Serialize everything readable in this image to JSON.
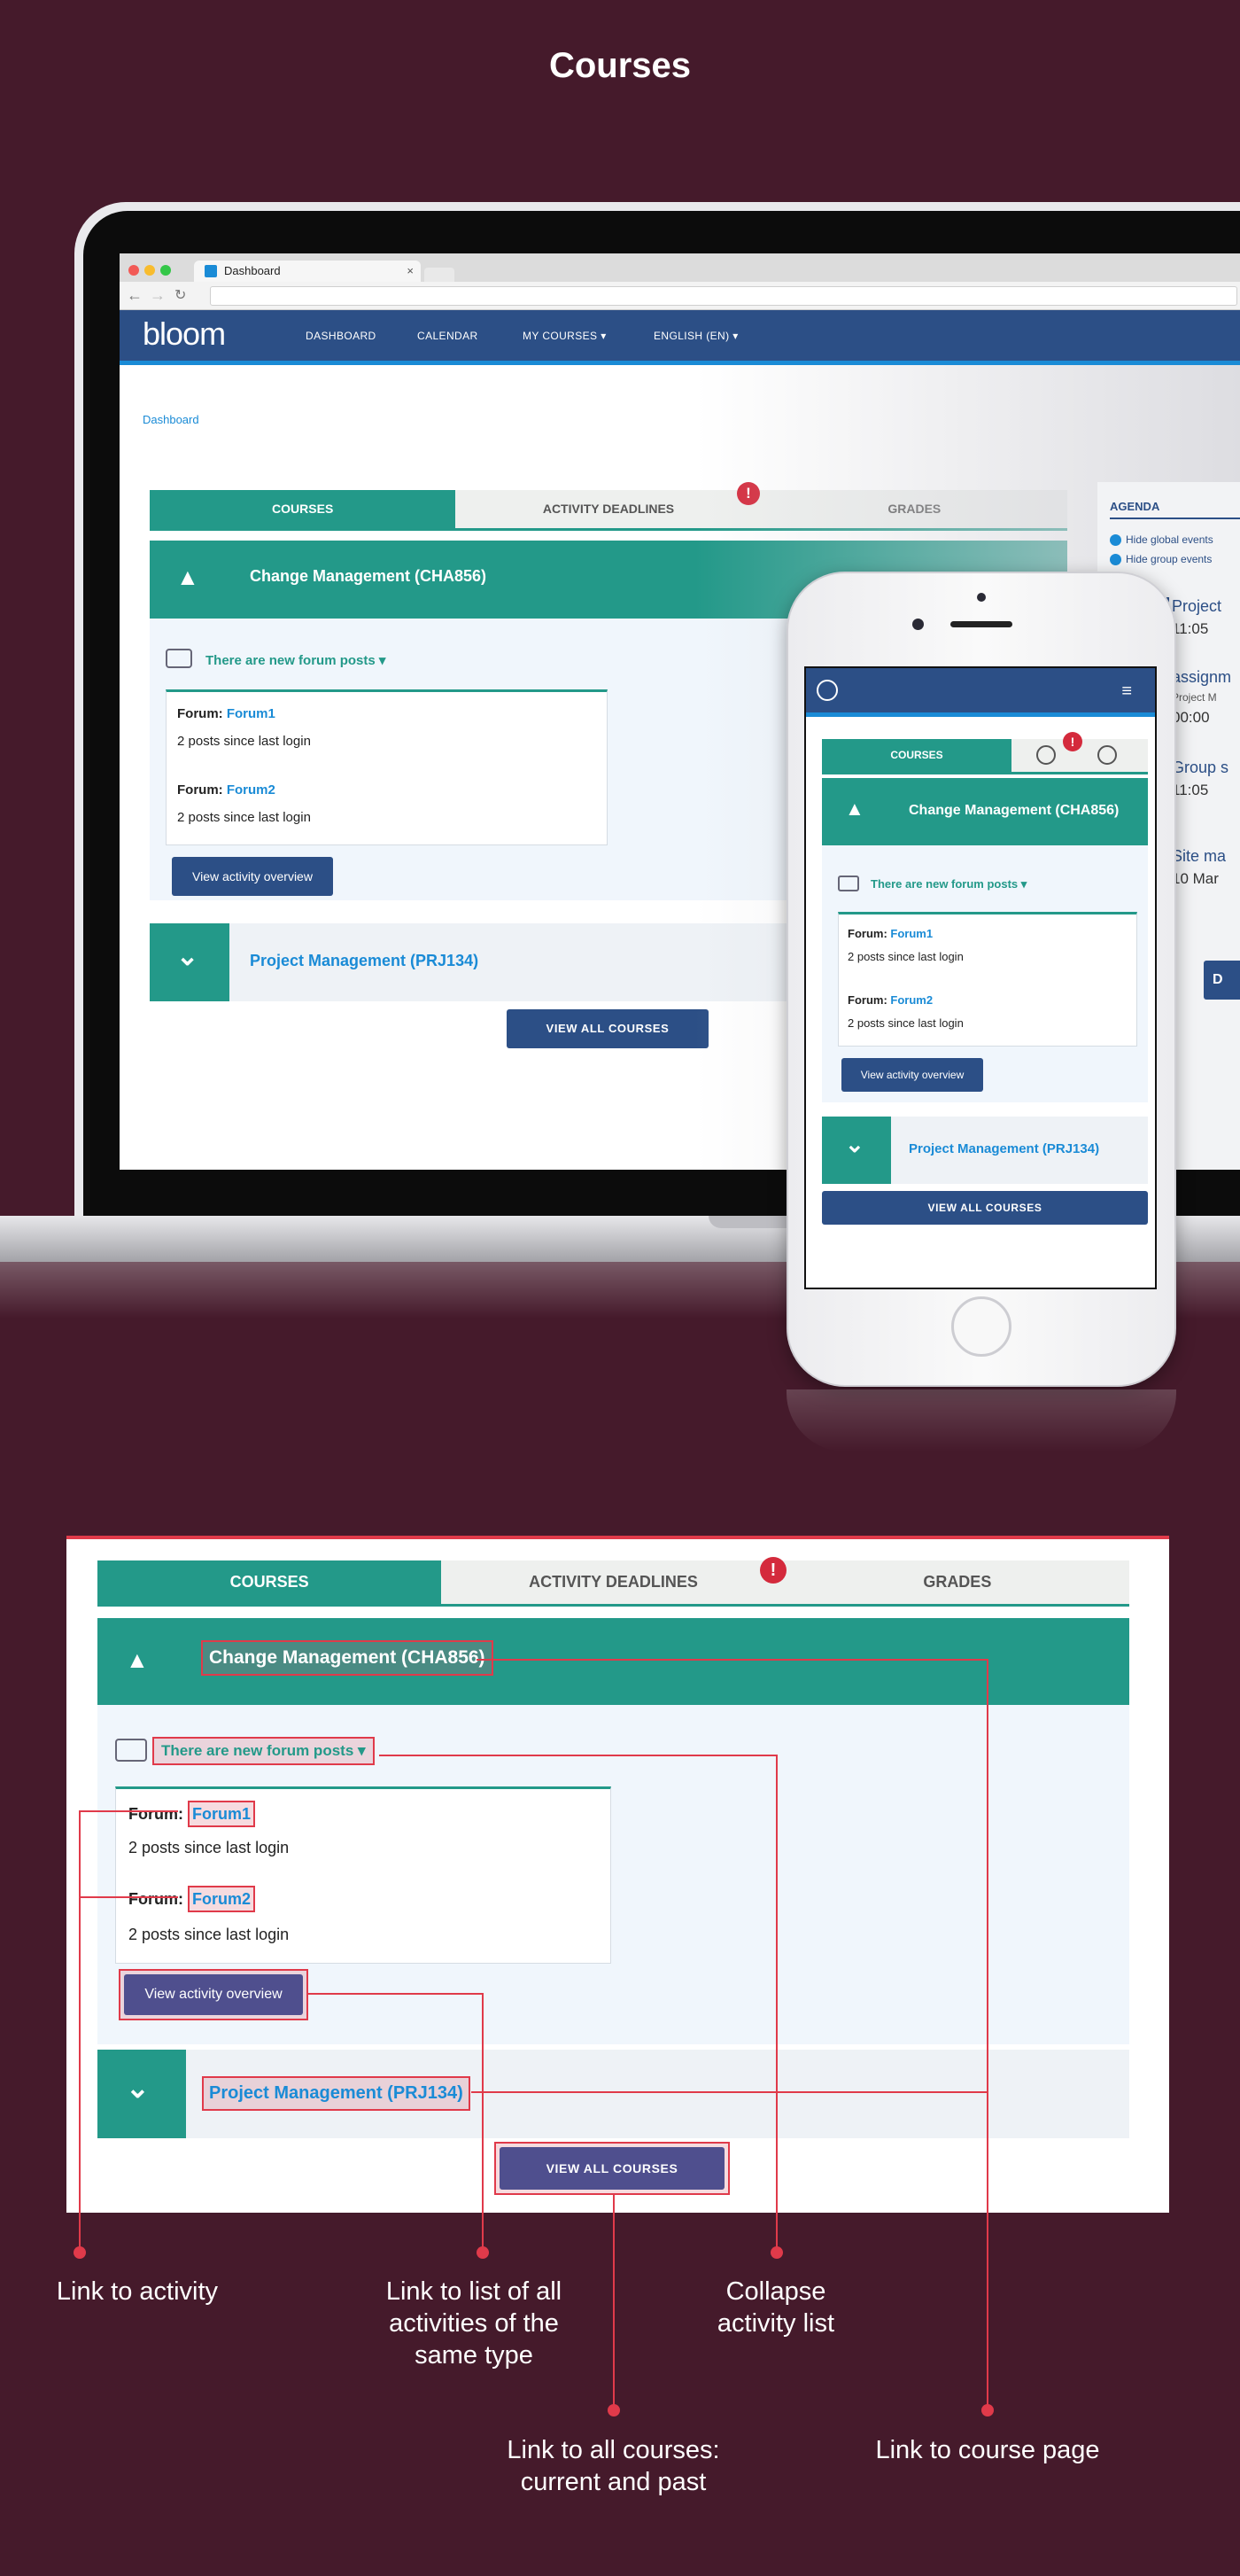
{
  "page_title": "Courses",
  "browser": {
    "tab_title": "Dashboard",
    "tab_close": "×",
    "back": "←",
    "forward": "→",
    "reload": "↻"
  },
  "app": {
    "logo": "bloom",
    "nav": {
      "dashboard": "DASHBOARD",
      "calendar": "CALENDAR",
      "my_courses": "MY COURSES ▾",
      "language": "ENGLISH (EN) ▾"
    },
    "breadcrumb": "Dashboard",
    "tabs": {
      "courses": "COURSES",
      "activity_deadlines": "ACTIVITY DEADLINES",
      "grades": "GRADES",
      "alert_glyph": "!"
    },
    "course1": {
      "name": "Change Management (CHA856)",
      "forum_notice": "There are new forum posts ▾",
      "forums": [
        {
          "prefix": "Forum:",
          "name": "Forum1",
          "count": "2 posts since last login"
        },
        {
          "prefix": "Forum:",
          "name": "Forum2",
          "count": "2 posts since last login"
        }
      ],
      "view_activity_button": "View activity overview"
    },
    "course2": {
      "name": "Project Management (PRJ134)"
    },
    "view_all_button": "VIEW ALL COURSES",
    "agenda": {
      "title": "AGENDA",
      "hide_global": "Hide global events",
      "hide_group": "Hide group events",
      "events": [
        {
          "title": "Project",
          "time": "11:05",
          "sub": ""
        },
        {
          "title": "assignm",
          "time": "00:00",
          "sub": "Project M"
        },
        {
          "title": "Group s",
          "time": "11:05",
          "sub": ""
        },
        {
          "title": "Site ma",
          "time": "10 Mar",
          "sub": ""
        }
      ],
      "button": "D"
    }
  },
  "phone": {
    "menu_glyph": "≡"
  },
  "icons": {
    "chevron_up": "▲",
    "chevron_down": "⌄",
    "forum": "forum-icon"
  },
  "annotations": {
    "link_to_activity": "Link to activity",
    "link_to_list": "Link to list of all activities of the same type",
    "collapse": "Collapse activity list",
    "link_all_courses": "Link to all courses: current and past",
    "link_course_page": "Link to course page"
  },
  "colors": {
    "background": "#451a2b",
    "teal": "#239989",
    "navy": "#2c4f86",
    "link": "#1a8bd6",
    "alert": "#d42a3c",
    "annotation": "#e03a4a"
  }
}
